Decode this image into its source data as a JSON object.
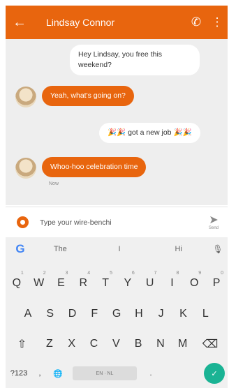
{
  "header": {
    "back_icon": "←",
    "title": "Lindsay Connor",
    "call_icon": "✆",
    "more_icon": "⋮",
    "accent_color": "#e8650e"
  },
  "messages": [
    {
      "direction": "out",
      "text": "Hey Lindsay, you free this weekend?"
    },
    {
      "direction": "in",
      "text": "Yeah, what's going on?"
    },
    {
      "direction": "out",
      "text": "🎉🎉 got a new job 🎉🎉"
    },
    {
      "direction": "in",
      "text": "Whoo-hoo celebration time",
      "meta": "Now"
    }
  ],
  "composer": {
    "text": "Type your wire-benchi",
    "send_icon": "➤",
    "send_label": "Send"
  },
  "keyboard": {
    "google_letter": "G",
    "suggestions": [
      "The",
      "I",
      "Hi"
    ],
    "mic_icon": "🎙",
    "row1": [
      "Q",
      "W",
      "E",
      "R",
      "T",
      "Y",
      "U",
      "I",
      "O",
      "P"
    ],
    "row1_hints": [
      "1",
      "2",
      "3",
      "4",
      "5",
      "6",
      "7",
      "8",
      "9",
      "0"
    ],
    "row2": [
      "A",
      "S",
      "D",
      "F",
      "G",
      "H",
      "J",
      "K",
      "L"
    ],
    "row3": [
      "Z",
      "X",
      "C",
      "V",
      "B",
      "N",
      "M"
    ],
    "shift_icon": "⇧",
    "delete_icon": "⌫",
    "symbols_label": "?123",
    "comma_label": ",",
    "globe_icon": "🌐",
    "space_label": "EN · NL",
    "period_label": ".",
    "enter_icon": "✓",
    "enter_color": "#1ab394"
  }
}
